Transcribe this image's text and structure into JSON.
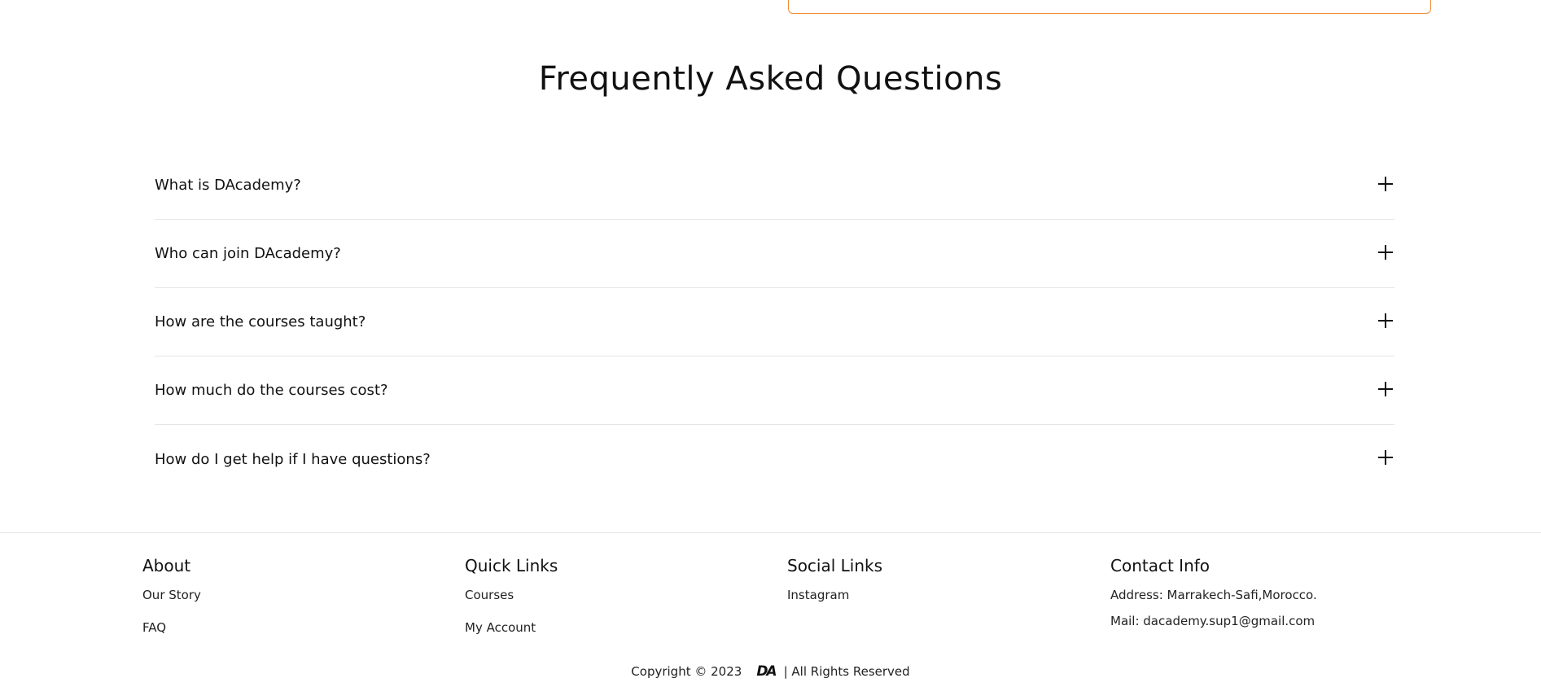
{
  "faq": {
    "title": "Frequently Asked Questions",
    "items": [
      {
        "question": "What is DAcademy?"
      },
      {
        "question": "Who can join DAcademy?"
      },
      {
        "question": "How are the courses taught?"
      },
      {
        "question": "How much do the courses cost?"
      },
      {
        "question": "How do I get help if I have questions?"
      }
    ]
  },
  "footer": {
    "about": {
      "heading": "About",
      "links": [
        "Our Story",
        "FAQ"
      ]
    },
    "quick_links": {
      "heading": "Quick Links",
      "links": [
        "Courses",
        "My Account"
      ]
    },
    "social_links": {
      "heading": "Social Links",
      "links": [
        "Instagram"
      ]
    },
    "contact_info": {
      "heading": "Contact Info",
      "address": "Address: Marrakech-Safi,Morocco.",
      "mail": "Mail: dacademy.sup1@gmail.com"
    },
    "copyright_prefix": "Copyright © 2023",
    "logo_text": "DA",
    "copyright_suffix": "| All Rights Reserved"
  },
  "colors": {
    "accent": "#f28c38",
    "divider": "#e6e6e6",
    "text": "#111111"
  },
  "icons": {
    "faq_toggle": "plus-icon"
  }
}
